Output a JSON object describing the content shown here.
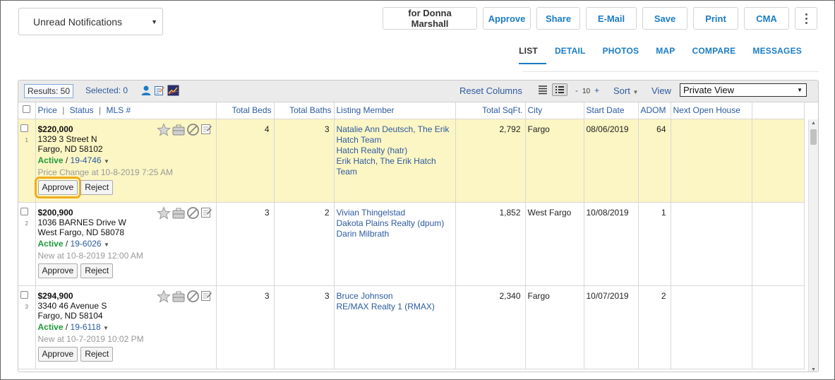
{
  "notifications": {
    "label": "Unread Notifications"
  },
  "toolbar": {
    "owner": "for Donna Marshall",
    "approve": "Approve",
    "share": "Share",
    "email": "E-Mail",
    "save": "Save",
    "print": "Print",
    "cma": "CMA"
  },
  "view_tabs": [
    "LIST",
    "DETAIL",
    "PHOTOS",
    "MAP",
    "COMPARE",
    "MESSAGES"
  ],
  "panel": {
    "results": "Results: 50",
    "selected": "Selected: 0",
    "reset_columns": "Reset Columns",
    "pager_minus": "-",
    "page_size": "10",
    "pager_plus": "+",
    "sort": "Sort",
    "view_label": "View",
    "view_value": "Private View"
  },
  "columns": {
    "price": "Price",
    "status": "Status",
    "mls": "MLS #",
    "sep": "|",
    "beds": "Total Beds",
    "baths": "Total Baths",
    "member": "Listing Member",
    "sqft": "Total SqFt.",
    "city": "City",
    "start": "Start Date",
    "adom": "ADOM",
    "open_house": "Next Open House"
  },
  "rows": [
    {
      "num": "1",
      "price": "$220,000",
      "addr1": "1329 3 Street N",
      "addr2": "Fargo, ND 58102",
      "status": "Active",
      "mls": "19-4746",
      "note": "Price Change at 10-8-2019 7:25 AM",
      "approve": "Approve",
      "reject": "Reject",
      "beds": "4",
      "baths": "3",
      "member": [
        "Natalie Ann Deutsch, The Erik Hatch Team",
        "Hatch Realty (hatr)",
        "Erik Hatch, The Erik Hatch Team"
      ],
      "sqft": "2,792",
      "city": "Fargo",
      "start": "08/06/2019",
      "adom": "64"
    },
    {
      "num": "2",
      "price": "$200,900",
      "addr1": "1036 BARNES Drive W",
      "addr2": "West Fargo, ND 58078",
      "status": "Active",
      "mls": "19-6026",
      "note": "New at 10-8-2019 12:00 AM",
      "approve": "Approve",
      "reject": "Reject",
      "beds": "3",
      "baths": "2",
      "member": [
        "Vivian Thingelstad",
        "Dakota Plains Realty (dpum)",
        "Darin Milbrath"
      ],
      "sqft": "1,852",
      "city": "West Fargo",
      "start": "10/08/2019",
      "adom": "1"
    },
    {
      "num": "3",
      "price": "$294,900",
      "addr1": "3340 46 Avenue S",
      "addr2": "Fargo, ND 58104",
      "status": "Active",
      "mls": "19-6118",
      "note": "New at 10-7-2019 10:02 PM",
      "approve": "Approve",
      "reject": "Reject",
      "beds": "3",
      "baths": "3",
      "member": [
        "Bruce Johnson",
        "RE/MAX Realty 1 (RMAX)"
      ],
      "sqft": "2,340",
      "city": "Fargo",
      "start": "10/07/2019",
      "adom": "2"
    }
  ],
  "colors": {
    "link": "#2d5aa0",
    "active_status": "#1e9a3a",
    "highlight_row": "#fcf6c4",
    "focus_outline": "#f0ad1c"
  }
}
